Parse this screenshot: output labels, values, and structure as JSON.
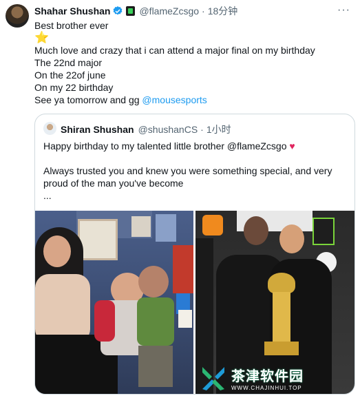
{
  "tweet": {
    "author_name": "Shahar Shushan",
    "author_handle": "@flameZcsgo",
    "separator": "·",
    "time": "18分钟",
    "more_label": "···",
    "lines": [
      "Best brother ever",
      "⭐",
      "Much love and crazy that i can attend a major final on my birthday",
      "The 22nd major",
      "On the 22of june",
      "On my 22 birthday"
    ],
    "last_line_prefix": "See ya tomorrow and gg ",
    "mention": "@mousesports"
  },
  "quote": {
    "author_name": "Shiran Shushan",
    "author_handle": "@shushanCS",
    "separator": "·",
    "time": "1小时",
    "line1_prefix": "Happy birthday to my talented little brother @flameZcsgo ",
    "heart": "♥",
    "line2": "Always trusted you and knew you were something special, and very",
    "line3": "proud of the man you've become",
    "line4": "..."
  },
  "watermark": {
    "cn": "茶津软件园",
    "url": "WWW.CHAJINHUI.TOP"
  },
  "colors": {
    "accent": "#1d9bf0",
    "muted": "#536471",
    "border": "#cfd9de",
    "heart": "#e0245e",
    "star": "#f5b50a"
  },
  "icons": [
    "verified-badge-icon",
    "affiliate-badge-icon",
    "more-icon",
    "heart-icon",
    "star-icon"
  ]
}
